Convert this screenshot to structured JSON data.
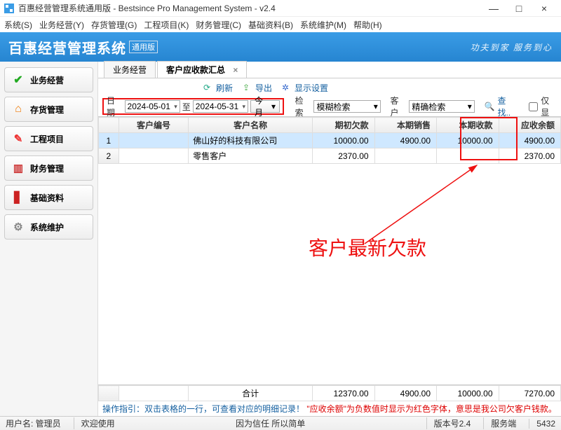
{
  "window": {
    "title": "百惠经营管理系统通用版 - Bestsince Pro Management System - v2.4",
    "min": "—",
    "max": "□",
    "close": "×"
  },
  "menu": [
    "系统(S)",
    "业务经营(Y)",
    "存货管理(G)",
    "工程项目(K)",
    "财务管理(C)",
    "基础资料(B)",
    "系统维护(M)",
    "帮助(H)"
  ],
  "banner": {
    "title": "百惠经营管理系统",
    "badge": "通用版",
    "slogan": "功夫到家 服务到心"
  },
  "sidebar": [
    {
      "icon": "✓",
      "color": "#2a2",
      "label": "业务经营"
    },
    {
      "icon": "⌂",
      "color": "#e70",
      "label": "存货管理"
    },
    {
      "icon": "✎",
      "color": "#e33",
      "label": "工程项目"
    },
    {
      "icon": "▥",
      "color": "#c33",
      "label": "财务管理"
    },
    {
      "icon": "■",
      "color": "#c22",
      "label": "基础资料"
    },
    {
      "icon": "⚙",
      "color": "#888",
      "label": "系统维护"
    }
  ],
  "tabs": [
    {
      "label": "业务经营",
      "active": false,
      "closable": false
    },
    {
      "label": "客户应收款汇总",
      "active": true,
      "closable": true
    }
  ],
  "toolbar1": {
    "refresh": "刷新",
    "export": "导出",
    "display": "显示设置"
  },
  "filter": {
    "dateLabel": "日期",
    "from": "2024-05-01",
    "toLabel": "至",
    "to": "2024-05-31",
    "monthBtn": "今月",
    "searchLabel": "检索",
    "searchMode": "模糊检索",
    "custLabel": "客户",
    "custMode": "精确检索",
    "findLabel": "查找..",
    "onlyLabel": "仅显"
  },
  "columns": [
    "",
    "客户编号",
    "客户名称",
    "期初欠款",
    "本期销售",
    "本期收款",
    "应收余额"
  ],
  "rows": [
    {
      "n": "1",
      "code": "",
      "name": "佛山好的科技有限公司",
      "open": "10000.00",
      "sale": "4900.00",
      "recv": "10000.00",
      "bal": "4900.00",
      "sel": true
    },
    {
      "n": "2",
      "code": "",
      "name": "零售客户",
      "open": "2370.00",
      "sale": "",
      "recv": "",
      "bal": "2370.00",
      "sel": false
    }
  ],
  "totals": {
    "label": "合计",
    "open": "12370.00",
    "sale": "4900.00",
    "recv": "10000.00",
    "bal": "7270.00"
  },
  "hint": {
    "prefix": "操作指引：双击表格的一行，可查看对应的明细记录！",
    "red": "\"应收余额\"为负数值时显示为红色字体，意思是我公司欠客户钱款。"
  },
  "annotation": "客户最新欠款",
  "status": {
    "user": "用户名: 管理员",
    "welcome": "欢迎使用",
    "motto": "因为信任 所以简单",
    "ver": "版本号2.4",
    "srv": "服务端",
    "num": "5432"
  }
}
